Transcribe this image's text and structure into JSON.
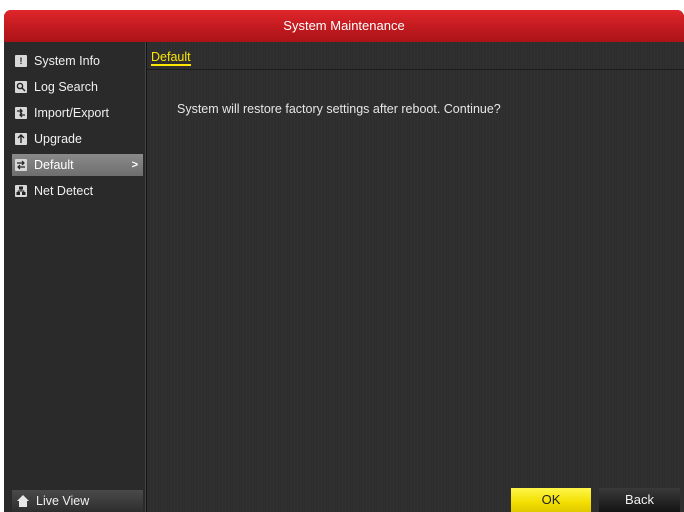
{
  "window": {
    "title": "System Maintenance"
  },
  "sidebar": {
    "items": [
      {
        "label": "System Info",
        "icon": "info-icon",
        "active": false
      },
      {
        "label": "Log Search",
        "icon": "log-search-icon",
        "active": false
      },
      {
        "label": "Import/Export",
        "icon": "import-export-icon",
        "active": false
      },
      {
        "label": "Upgrade",
        "icon": "upgrade-icon",
        "active": false
      },
      {
        "label": "Default",
        "icon": "default-restore-icon",
        "active": true,
        "arrow": ">"
      },
      {
        "label": "Net Detect",
        "icon": "net-detect-icon",
        "active": false
      }
    ],
    "live_view_label": "Live View"
  },
  "content": {
    "tab_label": "Default",
    "message": "System will restore factory settings after reboot. Continue?"
  },
  "buttons": {
    "ok_label": "OK",
    "back_label": "Back"
  },
  "colors": {
    "title_red": "#d21f25",
    "accent_yellow": "#ffe600",
    "ok_yellow": "#f2df00"
  }
}
